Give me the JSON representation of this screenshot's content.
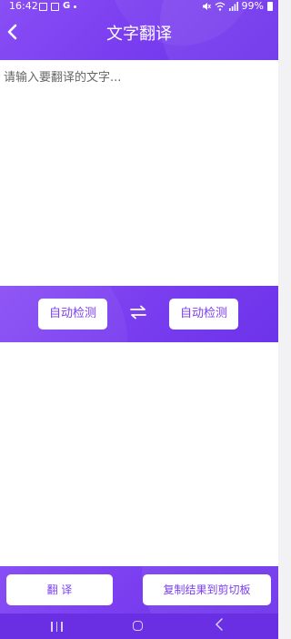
{
  "status_bar": {
    "time": "16:42",
    "battery": "99%",
    "icons_left": [
      "image-icon",
      "check-box-icon",
      "google-icon",
      "dot-icon"
    ],
    "icons_right": [
      "mute-icon",
      "wifi-icon",
      "signal-icon",
      "battery-icon"
    ]
  },
  "header": {
    "title": "文字翻译",
    "back_icon": "chevron-left-icon"
  },
  "input": {
    "placeholder": "请输入要翻译的文字...",
    "value": ""
  },
  "language_bar": {
    "source_label": "自动检测",
    "target_label": "自动检测",
    "swap_icon": "swap-arrows-icon"
  },
  "actions": {
    "translate_label": "翻 译",
    "copy_label": "复制结果到剪切板"
  },
  "colors": {
    "accent": "#7b3ff0",
    "accent_dark": "#6a2fe3",
    "panel": "#ffffff"
  }
}
